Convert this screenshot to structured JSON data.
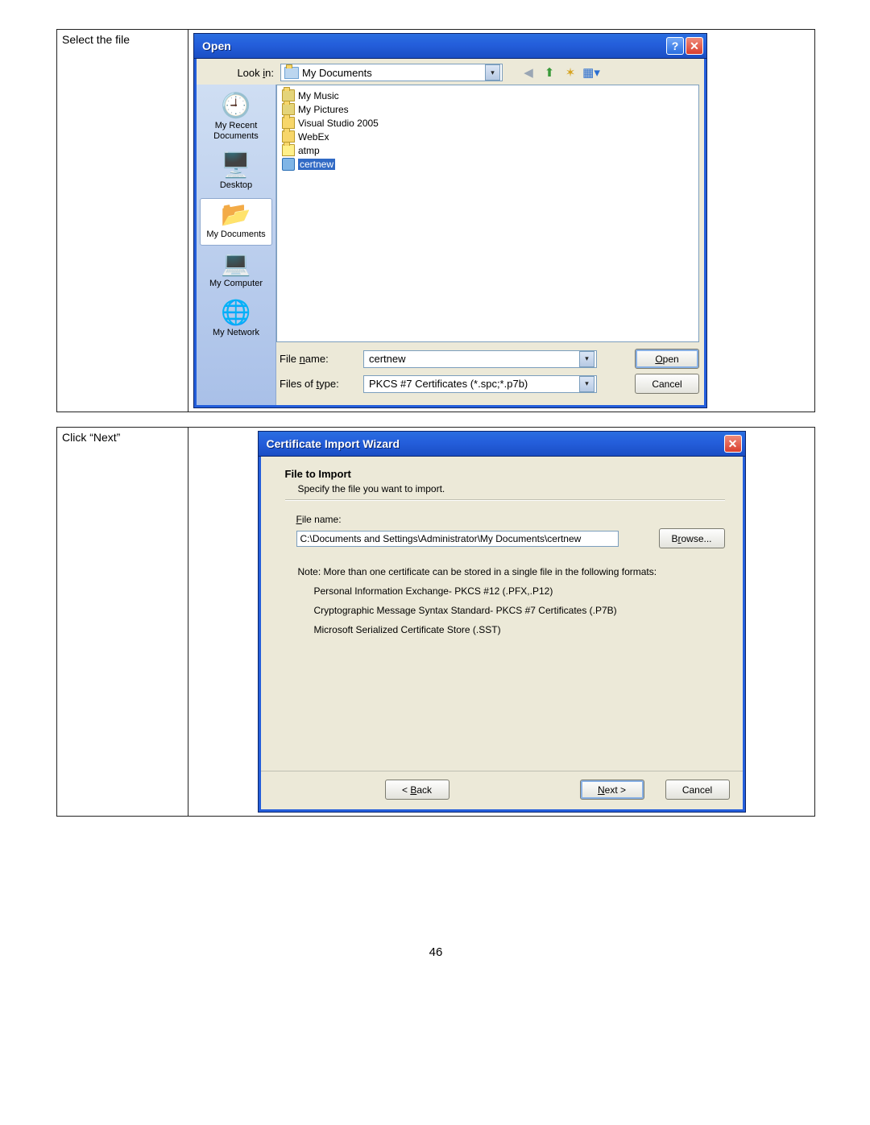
{
  "row1": {
    "instruction": "Select  the file"
  },
  "row2": {
    "instruction": "Click “Next”"
  },
  "page_number": "46",
  "open_dialog": {
    "title": "Open",
    "lookin_label": "Look in:",
    "lookin_value": "My Documents",
    "places": [
      {
        "label": "My Recent Documents"
      },
      {
        "label": "Desktop"
      },
      {
        "label": "My Documents"
      },
      {
        "label": "My Computer"
      },
      {
        "label": "My Network"
      }
    ],
    "files": [
      {
        "name": "My Music",
        "type": "sysfolder"
      },
      {
        "name": "My Pictures",
        "type": "sysfolder"
      },
      {
        "name": "Visual Studio 2005",
        "type": "folder"
      },
      {
        "name": "WebEx",
        "type": "folder"
      },
      {
        "name": "atmp",
        "type": "funny"
      },
      {
        "name": "certnew",
        "type": "cert",
        "selected": true
      }
    ],
    "filename_label": "File name:",
    "filename_value": "certnew",
    "filetype_label": "Files of type:",
    "filetype_value": "PKCS #7 Certificates (*.spc;*.p7b)",
    "open_btn": "Open",
    "cancel_btn": "Cancel"
  },
  "wizard": {
    "title": "Certificate Import Wizard",
    "heading": "File to Import",
    "subheading": "Specify the file you want to import.",
    "filename_label": "File name:",
    "filename_value": "C:\\Documents and Settings\\Administrator\\My Documents\\certnew",
    "browse_btn": "Browse...",
    "note": "Note:  More than one certificate can be stored in a single file in the following formats:",
    "fmt1": "Personal Information Exchange- PKCS #12 (.PFX,.P12)",
    "fmt2": "Cryptographic Message Syntax Standard- PKCS #7 Certificates (.P7B)",
    "fmt3": "Microsoft Serialized Certificate Store (.SST)",
    "back_btn": "< Back",
    "next_btn": "Next >",
    "cancel_btn": "Cancel"
  }
}
